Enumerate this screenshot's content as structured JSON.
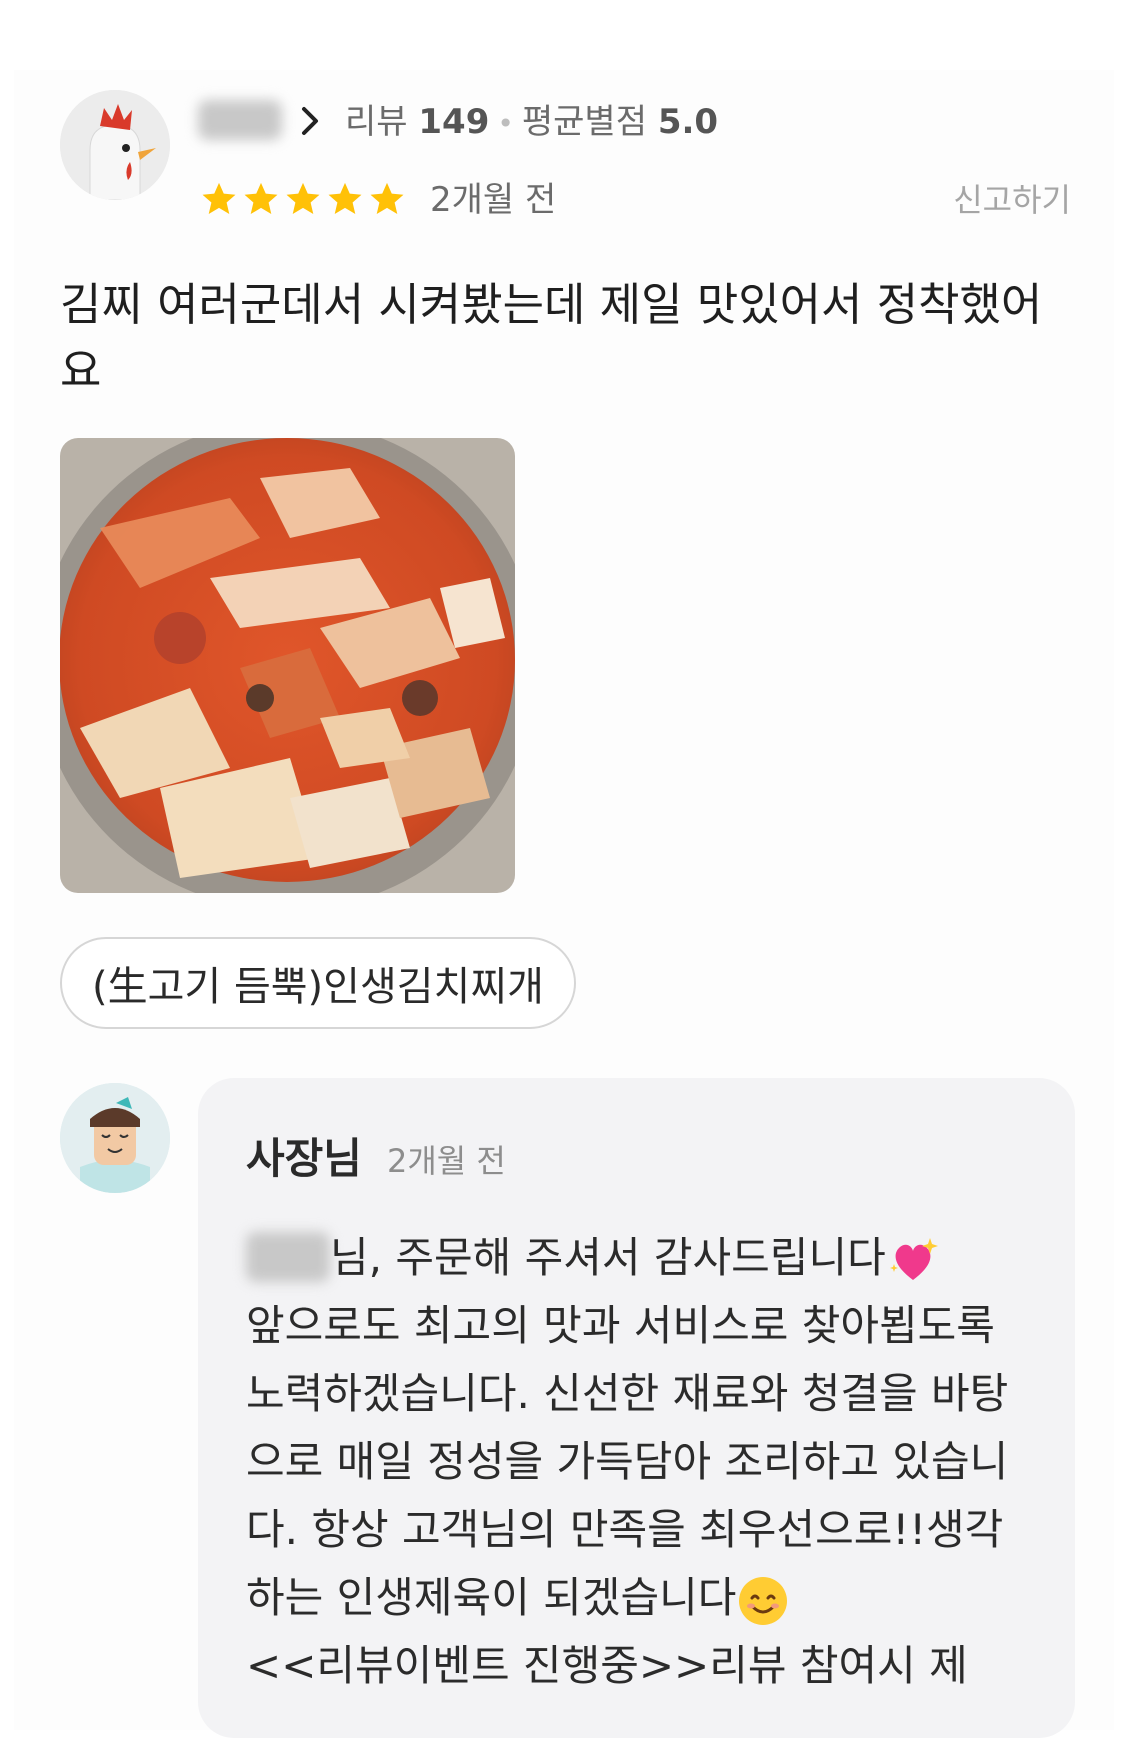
{
  "review": {
    "stats_label": "리뷰",
    "review_count": "149",
    "avg_label": "평균별점",
    "avg_score": "5.0",
    "rating": 5,
    "time": "2개월 전",
    "report_label": "신고하기",
    "text": "김찌 여러군데서 시켜봤는데 제일 맛있어서 정착했어요",
    "menu_item": "(生고기 듬뿍)인생김치찌개"
  },
  "reply": {
    "author": "사장님",
    "time": "2개월 전",
    "line1": "님,  주문해 주셔서 감사드립니다",
    "line2": "앞으로도 최고의 맛과 서비스로 찾아뵙도록 노력하겠습니다. 신선한 재료와 청결을 바탕으로 매일 정성을 가득담아 조리하고 있습니다. 항상 고객님의 만족을 최우선으로!!생각하는 인생제육이 되겠습니다",
    "line3": "<<리뷰이벤트 진행중>>리뷰 참여시 제"
  },
  "icons": {
    "star_color": "#ffc107",
    "heart_emoji": "sparkling-heart",
    "smile_emoji": "smiling-face"
  }
}
